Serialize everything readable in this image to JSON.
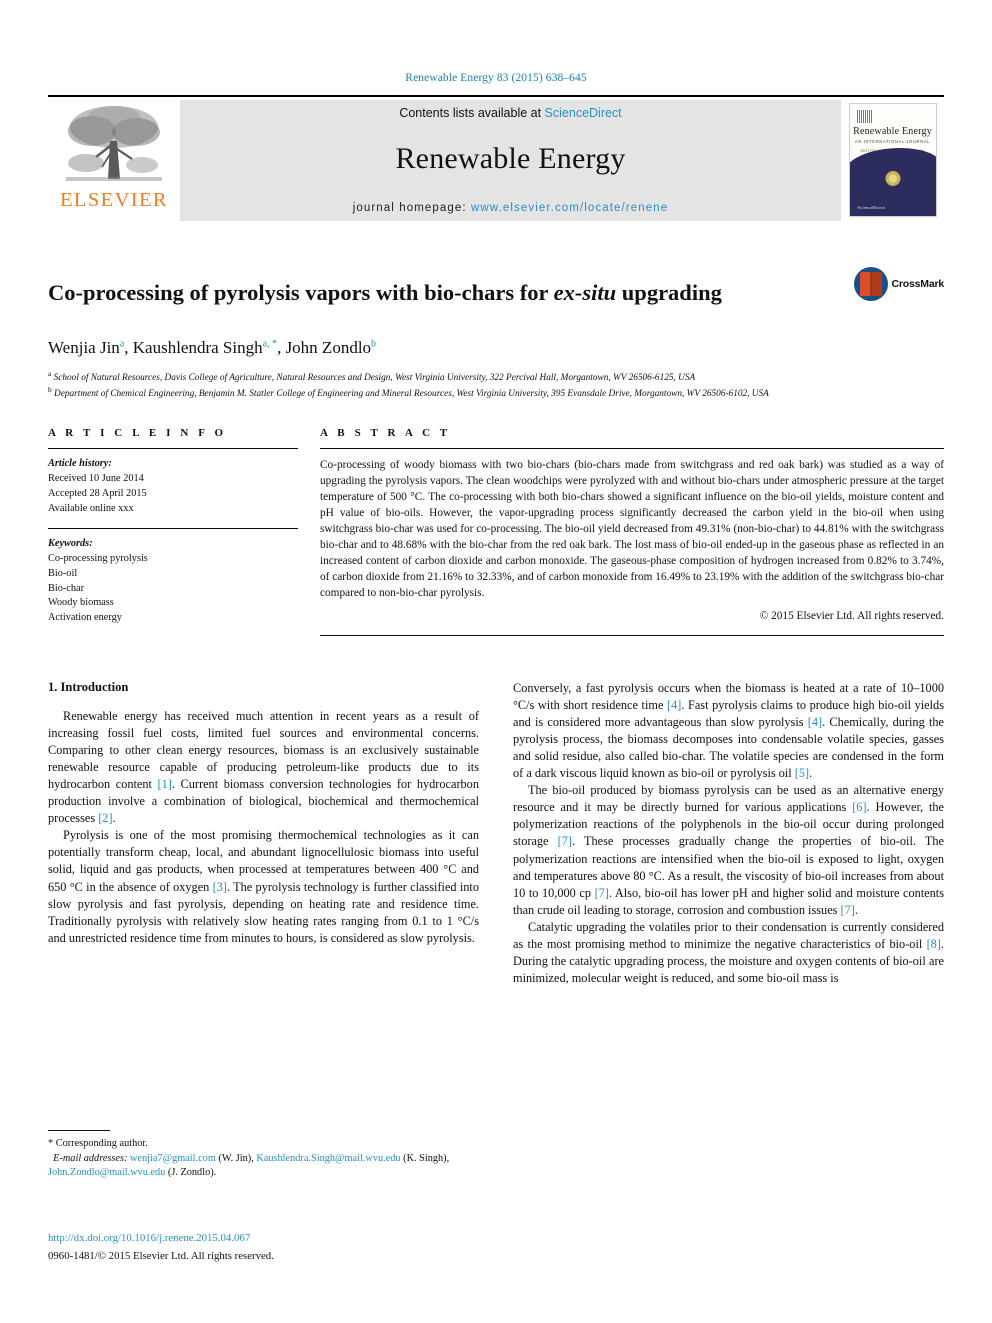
{
  "running_head": "Renewable Energy 83 (2015) 638–645",
  "masthead": {
    "publisher_logo_text": "ELSEVIER",
    "contents_prefix": "Contents lists available at ",
    "contents_link": "ScienceDirect",
    "journal_name": "Renewable Energy",
    "homepage_prefix": "journal homepage: ",
    "homepage_url": "www.elsevier.com/locate/renene",
    "cover": {
      "title": "Renewable Energy",
      "subtitle": "AN INTERNATIONAL JOURNAL",
      "subtitle2": "EDITOR-IN-CHIEF: A.A.M. Sayigh",
      "footer": "Available online at\nScienceDirect"
    }
  },
  "article": {
    "title_plain": "Co-processing of pyrolysis vapors with bio-chars for ",
    "title_italic": "ex-situ",
    "title_tail": " upgrading",
    "crossmark_label": "CrossMark",
    "authors": [
      {
        "name": "Wenjia Jin",
        "marks": "a"
      },
      {
        "name": "Kaushlendra Singh",
        "marks": "a, *"
      },
      {
        "name": "John Zondlo",
        "marks": "b"
      }
    ],
    "affiliations": [
      {
        "mark": "a",
        "text": "School of Natural Resources, Davis College of Agriculture, Natural Resources and Design, West Virginia University, 322 Percival Hall, Morgantown, WV 26506-6125, USA"
      },
      {
        "mark": "b",
        "text": "Department of Chemical Engineering, Benjamin M. Statler College of Engineering and Mineral Resources, West Virginia University, 395 Evansdale Drive, Morgantown, WV 26506-6102, USA"
      }
    ]
  },
  "article_info": {
    "heading": "A R T I C L E  I N F O",
    "history_label": "Article history:",
    "history": [
      "Received 10 June 2014",
      "Accepted 28 April 2015",
      "Available online xxx"
    ],
    "keywords_label": "Keywords:",
    "keywords": [
      "Co-processing pyrolysis",
      "Bio-oil",
      "Bio-char",
      "Woody biomass",
      "Activation energy"
    ]
  },
  "abstract": {
    "heading": "A B S T R A C T",
    "text": "Co-processing of woody biomass with two bio-chars (bio-chars made from switchgrass and red oak bark) was studied as a way of upgrading the pyrolysis vapors. The clean woodchips were pyrolyzed with and without bio-chars under atmospheric pressure at the target temperature of 500 °C. The co-processing with both bio-chars showed a significant influence on the bio-oil yields, moisture content and pH value of bio-oils. However, the vapor-upgrading process significantly decreased the carbon yield in the bio-oil when using switchgrass bio-char was used for co-processing. The bio-oil yield decreased from 49.31% (non-bio-char) to 44.81% with the switchgrass bio-char and to 48.68% with the bio-char from the red oak bark. The lost mass of bio-oil ended-up in the gaseous phase as reflected in an increased content of carbon dioxide and carbon monoxide. The gaseous-phase composition of hydrogen increased from 0.82% to 3.74%, of carbon dioxide from 21.16% to 32.33%, and of carbon monoxide from 16.49% to 23.19% with the addition of the switchgrass bio-char compared to non-bio-char pyrolysis.",
    "copyright": "© 2015 Elsevier Ltd. All rights reserved."
  },
  "body": {
    "section_heading": "1. Introduction",
    "left_paragraphs": [
      "Renewable energy has received much attention in recent years as a result of increasing fossil fuel costs, limited fuel sources and environmental concerns. Comparing to other clean energy resources, biomass is an exclusively sustainable renewable resource capable of producing petroleum-like products due to its hydrocarbon content [1]. Current biomass conversion technologies for hydrocarbon production involve a combination of biological, biochemical and thermochemical processes [2].",
      "Pyrolysis is one of the most promising thermochemical technologies as it can potentially transform cheap, local, and abundant lignocellulosic biomass into useful solid, liquid and gas products, when processed at temperatures between 400 °C and 650 °C in the absence of oxygen [3]. The pyrolysis technology is further classified into slow pyrolysis and fast pyrolysis, depending on heating rate and residence time. Traditionally pyrolysis with relatively slow heating rates ranging from 0.1 to 1 °C/s and unrestricted residence time from minutes to hours, is considered as slow pyrolysis."
    ],
    "right_paragraphs": [
      "Conversely, a fast pyrolysis occurs when the biomass is heated at a rate of 10–1000 °C/s with short residence time [4]. Fast pyrolysis claims to produce high bio-oil yields and is considered more advantageous than slow pyrolysis [4]. Chemically, during the pyrolysis process, the biomass decomposes into condensable volatile species, gasses and solid residue, also called bio-char. The volatile species are condensed in the form of a dark viscous liquid known as bio-oil or pyrolysis oil [5].",
      "The bio-oil produced by biomass pyrolysis can be used as an alternative energy resource and it may be directly burned for various applications [6]. However, the polymerization reactions of the polyphenols in the bio-oil occur during prolonged storage [7]. These processes gradually change the properties of bio-oil. The polymerization reactions are intensified when the bio-oil is exposed to light, oxygen and temperatures above 80 °C. As a result, the viscosity of bio-oil increases from about 10 to 10,000 cp [7]. Also, bio-oil has lower pH and higher solid and moisture contents than crude oil leading to storage, corrosion and combustion issues [7].",
      "Catalytic upgrading the volatiles prior to their condensation is currently considered as the most promising method to minimize the negative characteristics of bio-oil [8]. During the catalytic upgrading process, the moisture and oxygen contents of bio-oil are minimized, molecular weight is reduced, and some bio-oil mass is"
    ]
  },
  "footnote": {
    "corresponding": "* Corresponding author.",
    "email_label": "E-mail addresses:",
    "emails": [
      {
        "address": "wenjia7@gmail.com",
        "who": " (W. Jin), "
      },
      {
        "address": "Kaushlendra.Singh@mail.wvu.edu",
        "who": " (K. Singh), "
      },
      {
        "address": "John.Zondlo@mail.wvu.edu",
        "who": " (J. Zondlo)."
      }
    ],
    "doi": "http://dx.doi.org/10.1016/j.renene.2015.04.067",
    "issn": "0960-1481/© 2015 Elsevier Ltd. All rights reserved."
  },
  "colors": {
    "link_blue": "#2a8fc4",
    "elsevier_orange": "#f47c20",
    "cover_navy": "#2d2c5e",
    "crossmark_blue": "#1b4f8a",
    "crossmark_red": "#d94f2a"
  }
}
